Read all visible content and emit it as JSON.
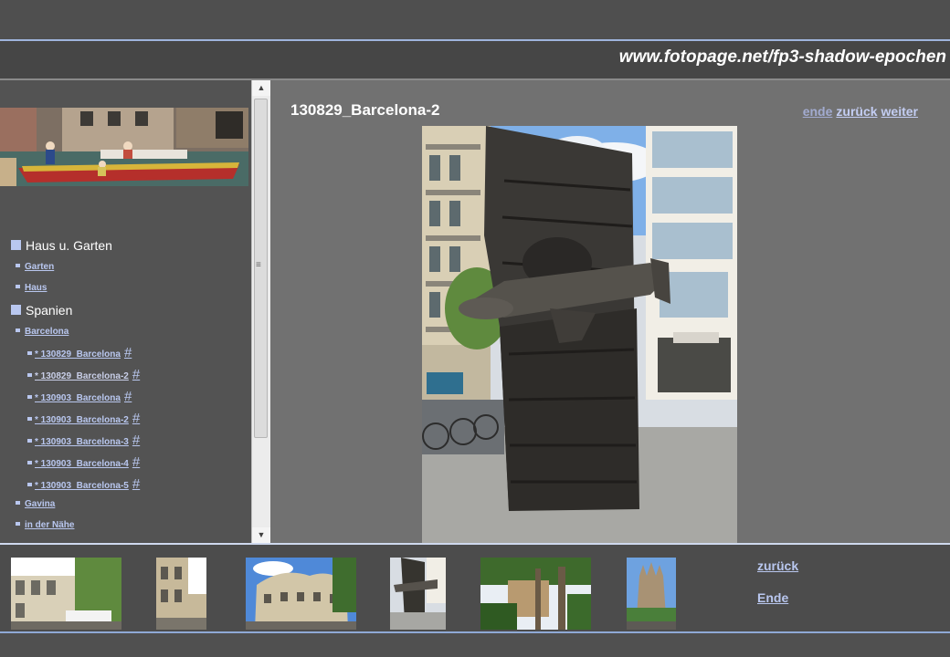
{
  "site": {
    "url": "www.fotopage.net/fp3-shadow-epochen"
  },
  "photo": {
    "title": "130829_Barcelona-2"
  },
  "nav": {
    "end": "ende",
    "back": "zurück",
    "next": "weiter"
  },
  "sidebar": {
    "categories": [
      {
        "label": "Haus u. Garten",
        "items": [
          "Garten",
          "Haus"
        ]
      },
      {
        "label": "Spanien",
        "items": [
          "Barcelona"
        ]
      }
    ],
    "barcelona_pages": [
      "* 130829_Barcelona",
      "* 130829_Barcelona-2",
      "* 130903_Barcelona",
      "* 130903_Barcelona-2",
      "* 130903_Barcelona-3",
      "* 130903_Barcelona-4",
      "* 130903_Barcelona-5"
    ],
    "hash": "#",
    "more_items": [
      "Gavina",
      "in der Nähe"
    ]
  },
  "filmstrip": {
    "back": "zurück",
    "end": "Ende"
  },
  "icons": {
    "category_bullet": "square-bullet-icon",
    "scroll_up": "arrow-up-icon",
    "scroll_down": "arrow-down-icon",
    "scroll_grip": "grip-icon"
  },
  "colors": {
    "link": "#b9c7ef",
    "accent_line": "#9fb4dd",
    "main_bg": "#717171",
    "sidebar_bg": "#535353"
  }
}
